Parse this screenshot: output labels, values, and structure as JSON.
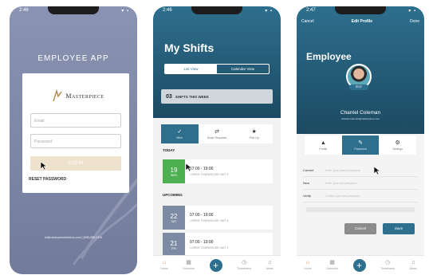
{
  "login": {
    "time": "2:46",
    "status_icons": "▾ ▪",
    "app_title": "EMPLOYEE APP",
    "logo_text": "Masterpiece",
    "email_placeholder": "Email",
    "password_placeholder": "Password",
    "login_label": "LOGIN",
    "reset_label": "RESET PASSWORD",
    "footer": "hr@masterpieceinteriors.com | (555) 555-1234"
  },
  "shifts": {
    "time": "2:46",
    "status_icons": "▾ ▪",
    "title": "My Shifts",
    "segments": [
      "List View",
      "Calendar View"
    ],
    "count_number": "03",
    "count_label": "SHIFTS THIS WEEK",
    "tabs": [
      {
        "icon": "✓",
        "label": "Mine"
      },
      {
        "icon": "⇄",
        "label": "Swap Requests"
      },
      {
        "icon": "★",
        "label": "Pick Up"
      }
    ],
    "today_label": "TODAY",
    "upcoming_label": "UPCOMING",
    "today_shift": {
      "day": "19",
      "dow": "WED",
      "time": "07:00 - 19:00",
      "location": "LOREM TOWNHOUSE UNIT 5"
    },
    "upcoming_shifts": [
      {
        "day": "22",
        "dow": "SAT",
        "time": "07:00 - 19:00",
        "location": "LOREM TOWNHOUSE UNIT 5"
      },
      {
        "day": "21",
        "dow": "FRI",
        "time": "07:00 - 19:00",
        "location": "LOREM TOWNHOUSE UNIT 5"
      }
    ],
    "colors": {
      "today": "#4caf50",
      "upcoming": "#7d8aa3",
      "accent": "#2e6f8e"
    }
  },
  "profile": {
    "time": "2:47",
    "status_icons": "▾ ▪",
    "cancel_label": "Cancel",
    "screen_title": "Edit Profile",
    "done_label": "Done",
    "heading": "Employee",
    "edit_badge": "EDIT",
    "name": "Chantel Coleman",
    "email": "chantel.coleman@masterpiece.com",
    "tabs": [
      {
        "icon": "▲",
        "label": "Profile"
      },
      {
        "icon": "✎",
        "label": "Password"
      },
      {
        "icon": "⚙",
        "label": "Settings"
      }
    ],
    "form": [
      {
        "label": "Current",
        "placeholder": "Enter your current password"
      },
      {
        "label": "New",
        "placeholder": "Enter your new password"
      },
      {
        "label": "Verify",
        "placeholder": "Confirm your new password"
      }
    ],
    "cancel_button": "Cancel",
    "save_button": "Save"
  },
  "navbar": {
    "items": [
      {
        "icon": "⌂",
        "label": "Home"
      },
      {
        "icon": "▦",
        "label": "Schedule"
      },
      {
        "icon": "+",
        "label": ""
      },
      {
        "icon": "◷",
        "label": "Timesheets"
      },
      {
        "icon": "♫",
        "label": "Alerts"
      }
    ]
  }
}
